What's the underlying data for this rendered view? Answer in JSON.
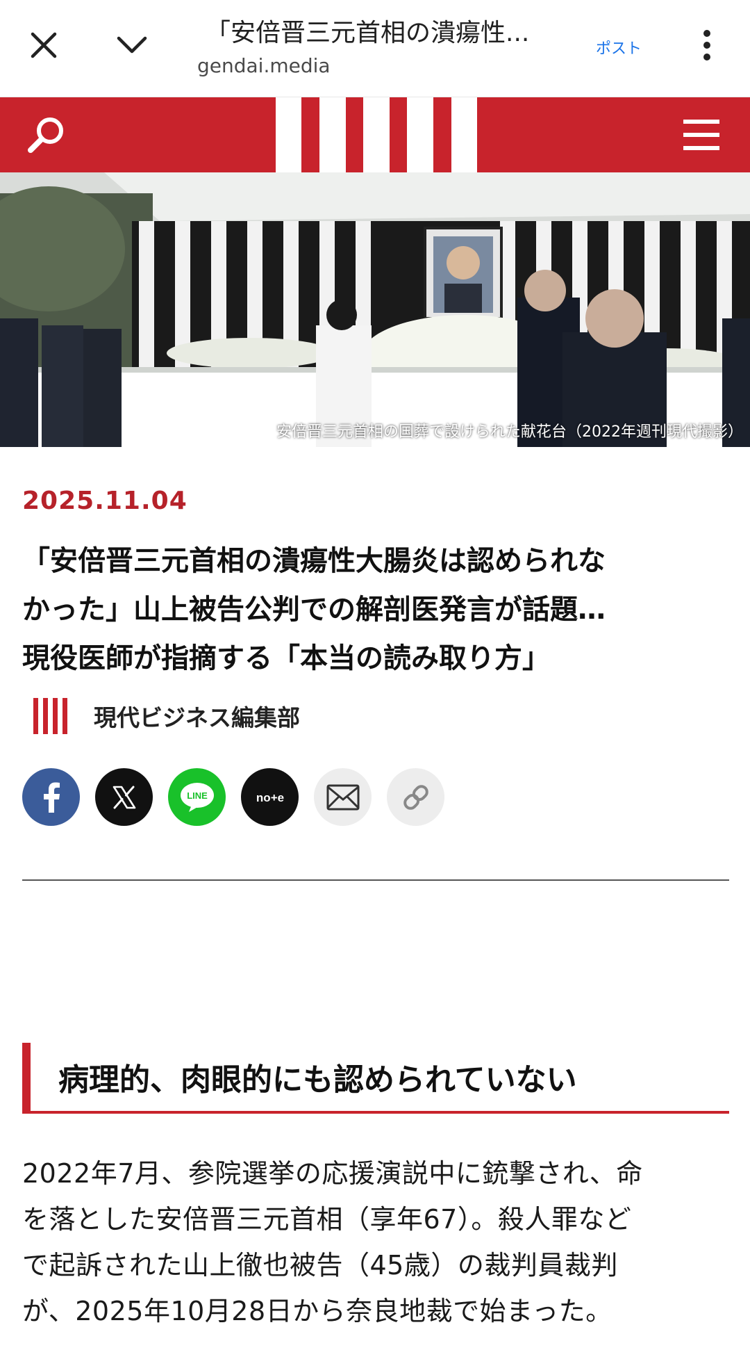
{
  "browser": {
    "page_title": "「安倍晋三元首相の潰瘍性...",
    "domain": "gendai.media",
    "post_label": "ポスト"
  },
  "icons": {
    "close": "close-icon",
    "collapse": "chevron-down-icon",
    "more": "more-vert-icon",
    "search": "search-icon",
    "menu": "hamburger-menu-icon",
    "logo": "gendai-stripes-logo",
    "facebook": "facebook-icon",
    "x": "x-icon",
    "line": "line-icon",
    "note": "note-icon",
    "mail": "mail-icon",
    "link": "link-icon"
  },
  "colors": {
    "brand_red": "#c8232c",
    "date_red": "#b6222a",
    "post_blue": "#1a73e8",
    "facebook": "#3b5c9a",
    "line": "#19c12a"
  },
  "hero": {
    "caption": "安倍晋三元首相の国葬で設けられた献花台（2022年週刊現代撮影）"
  },
  "article": {
    "date": "2025.11.04",
    "title_lines": [
      "「安倍晋三元首相の潰瘍性大腸炎は認められな",
      "かった」山上被告公判での解剖医発言が話題…",
      "現役医師が指摘する「本当の読み取り方」"
    ],
    "author": "現代ビジネス編集部",
    "share": {
      "note_label": "no+e"
    },
    "section_heading": "病理的、肉眼的にも認められていない",
    "body_lines": [
      "2022年7月、参院選挙の応援演説中に銃撃され、命",
      "を落とした安倍晋三元首相（享年67）。殺人罪など",
      "で起訴された山上徹也被告（45歳）の裁判員裁判",
      "が、2025年10月28日から奈良地裁で始まった。"
    ]
  }
}
